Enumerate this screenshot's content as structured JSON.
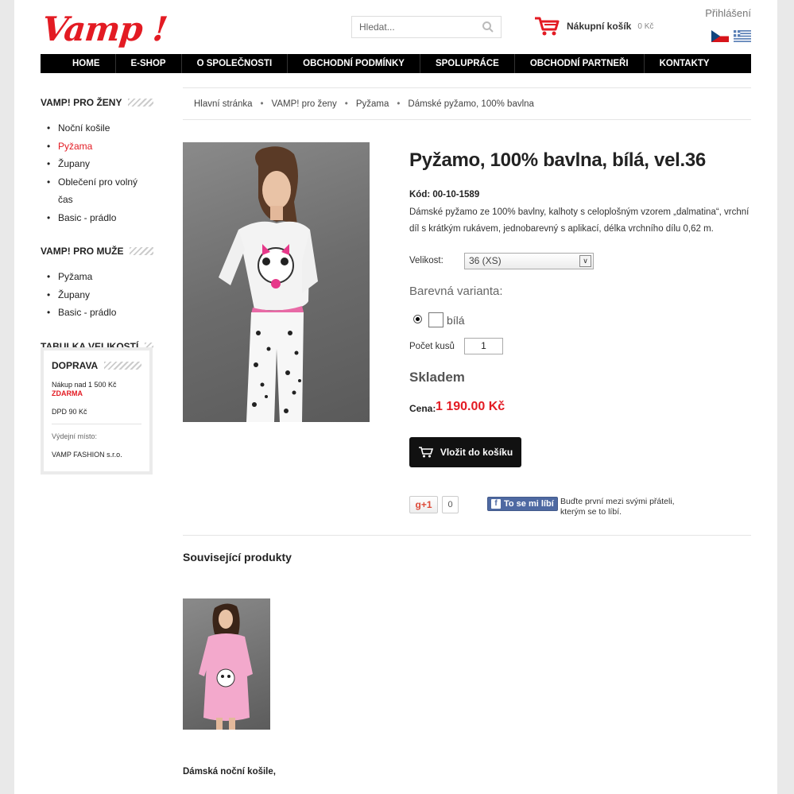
{
  "header": {
    "logo_text": "Vamp !",
    "search_placeholder": "Hledat...",
    "cart_label": "Nákupní košík",
    "cart_amount": "0 Kč",
    "login_label": "Přihlášení",
    "flags": [
      "czech-flag",
      "greek-flag"
    ]
  },
  "nav": [
    "HOME",
    "E-SHOP",
    "O SPOLEČNOSTI",
    "OBCHODNÍ PODMÍNKY",
    "SPOLUPRÁCE",
    "OBCHODNÍ PARTNEŘI",
    "KONTAKTY"
  ],
  "sidebar": {
    "women_title": "VAMP! PRO ŽENY",
    "women_items": [
      "Noční košile",
      "Pyžama",
      "Župany",
      "Oblečení pro volný čas",
      "Basic - prádlo"
    ],
    "men_title": "VAMP! PRO MUŽE",
    "men_items": [
      "Pyžama",
      "Župany",
      "Basic - prádlo"
    ],
    "sizes_title": "TABULKA VELIKOSTÍ",
    "shipping": {
      "title": "DOPRAVA",
      "line1": "Nákup nad 1 500 Kč",
      "line1_free": "ZDARMA",
      "line2": "DPD 90 Kč",
      "pickup_label": "Výdejní místo:",
      "pickup_value": "VAMP FASHION s.r.o."
    }
  },
  "breadcrumb": [
    "Hlavní stránka",
    "VAMP! pro ženy",
    "Pyžama",
    "Dámské pyžamo, 100% bavlna"
  ],
  "product": {
    "title": "Pyžamo, 100% bavlna, bílá, vel.36",
    "code_label": "Kód:",
    "code": "00-10-1589",
    "description": "Dámské pyžamo ze 100% bavlny, kalhoty s celoplošným vzorem „dalmatina“, vrchní díl s krátkým rukávem, jednobarevný s aplikací, délka vrchního dílu 0,62 m.",
    "size_label": "Velikost:",
    "size_value": "36 (XS)",
    "variant_label": "Barevná varianta:",
    "variant_value": "bílá",
    "qty_label": "Počet kusů",
    "qty_value": "1",
    "stock": "Skladem",
    "price_label": "Cena:",
    "price": "1 190.00 Kč",
    "buy_label": "Vložit do košíku"
  },
  "social": {
    "gplus_label": "+1",
    "gplus_count": "0",
    "fb_label": "To se mi líbí",
    "fb_text": "Buďte první mezi svými přáteli, kterým se to líbí."
  },
  "related": {
    "title": "Související produkty",
    "item_name": "Dámská noční košile,"
  },
  "colors": {
    "brand_red": "#e31b23",
    "nav_bg": "#000000"
  }
}
